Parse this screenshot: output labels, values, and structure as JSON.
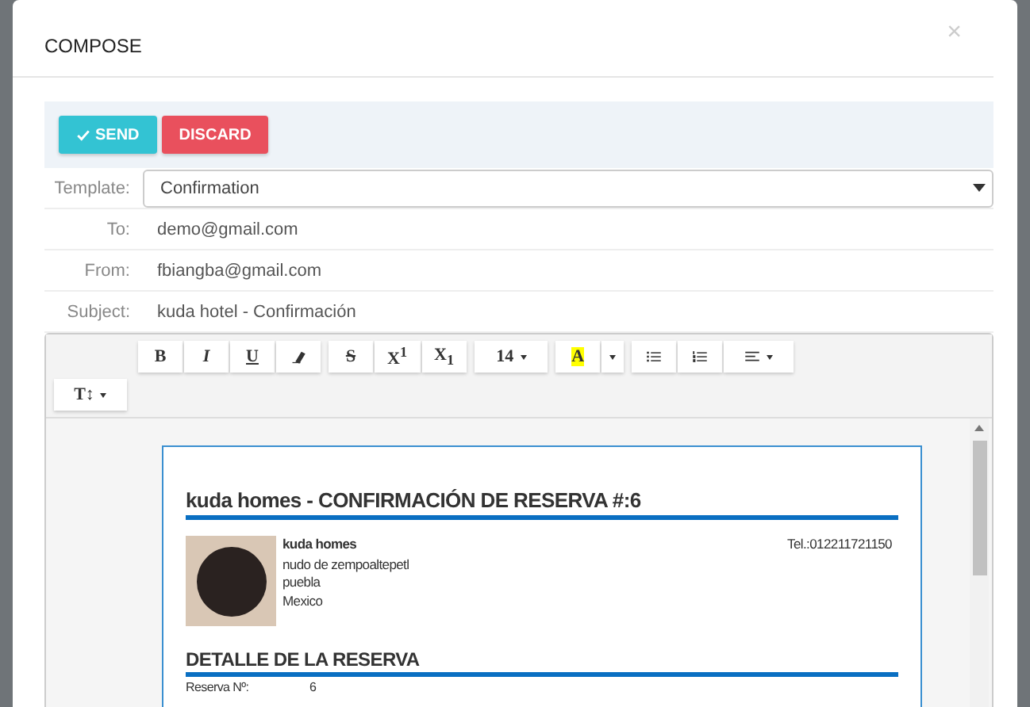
{
  "dialog": {
    "title": "COMPOSE",
    "close": "×"
  },
  "actions": [
    {
      "label": "SEND",
      "kind": "primary"
    },
    {
      "label": "DISCARD",
      "kind": "danger"
    }
  ],
  "fields": [
    {
      "label": "Template:",
      "kind": "select",
      "value": "Confirmation"
    },
    {
      "label": "To:",
      "kind": "text",
      "value": "demo@gmail.com"
    },
    {
      "label": "From:",
      "kind": "text",
      "value": "fbiangba@gmail.com"
    },
    {
      "label": "Subject:",
      "kind": "text",
      "value": "kuda hotel - Confirmación"
    }
  ],
  "toolbar": [
    [
      {
        "kind": "bold",
        "label": "B"
      },
      {
        "kind": "italic",
        "label": "I"
      },
      {
        "kind": "underline",
        "label": "U"
      },
      {
        "kind": "eraser"
      }
    ],
    [
      {
        "kind": "strike",
        "label": "S"
      },
      {
        "kind": "bold",
        "label": "X$^{1}$"
      },
      {
        "kind": "bold",
        "label": "X$_{1}$"
      }
    ],
    [
      {
        "kind": "dropdown",
        "label": "14"
      }
    ],
    [
      {
        "kind": "highlight",
        "label": "A"
      },
      {
        "kind": "caret"
      }
    ],
    [
      {
        "kind": "bullets"
      },
      {
        "kind": "numbers"
      },
      {
        "kind": "align"
      }
    ],
    [
      {
        "kind": "dropdown",
        "label": "T↕"
      }
    ]
  ],
  "document": {
    "title": "kuda homes - CONFIRMACIÓN DE RESERVA #:6",
    "hotel": {
      "name": "kuda homes",
      "address": [
        "nudo de zempoaltepetl",
        "puebla",
        "Mexico"
      ],
      "phone": "Tel.:012211721150"
    },
    "section": "DETALLE DE LA RESERVA",
    "rows": [
      {
        "label": "Reserva Nº:",
        "value": "6"
      }
    ]
  }
}
